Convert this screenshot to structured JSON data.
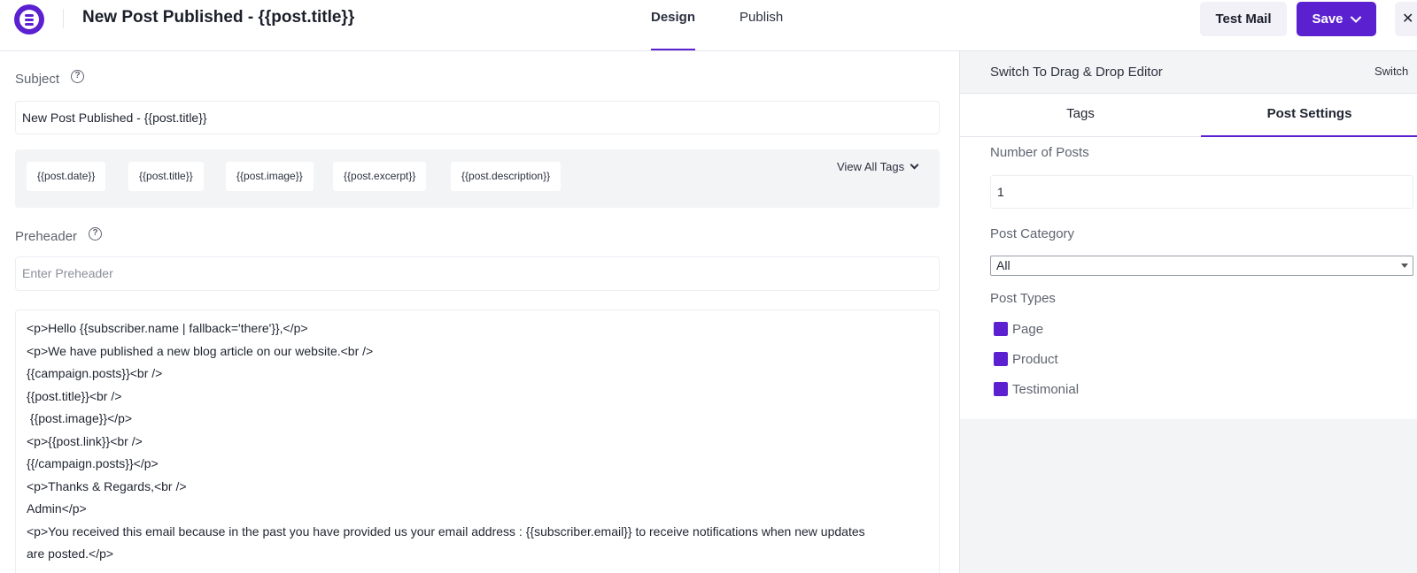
{
  "header": {
    "title": "New Post Published - {{post.title}}",
    "tabs": [
      "Design",
      "Publish"
    ],
    "test_mail_label": "Test Mail",
    "save_label": "Save",
    "close_glyph": "✕"
  },
  "editor": {
    "subject_label": "Subject",
    "subject_value": "New Post Published - {{post.title}}",
    "tags": [
      "{{post.date}}",
      "{{post.title}}",
      "{{post.image}}",
      "{{post.excerpt}}",
      "{{post.description}}"
    ],
    "view_all_tags_label": "View All Tags",
    "preheader_label": "Preheader",
    "preheader_placeholder": "Enter Preheader",
    "body_lines": [
      "<p>Hello {{subscriber.name | fallback='there'}},</p>",
      "<p>We have published a new blog article on our website.<br />",
      "{{campaign.posts}}<br />",
      "{{post.title}}<br />",
      " {{post.image}}</p>",
      "<p>{{post.link}}<br />",
      "{{/campaign.posts}}</p>",
      "<p>Thanks & Regards,<br />",
      "Admin</p>",
      "<p>You received this email because in the past you have provided us your email address : {{subscriber.email}} to receive notifications when new updates",
      "are posted.</p>"
    ]
  },
  "sidebar": {
    "switch_text": "Switch To Drag & Drop Editor",
    "switch_button": "Switch",
    "tabs": [
      "Tags",
      "Post Settings"
    ],
    "number_of_posts_label": "Number of Posts",
    "number_of_posts_value": "1",
    "post_category_label": "Post Category",
    "post_category_value": "All",
    "post_types_label": "Post Types",
    "post_types": [
      "Page",
      "Product",
      "Testimonial"
    ]
  },
  "colors": {
    "accent": "#5b21d1",
    "panel_bg": "#f3f4f6",
    "chip_bg": "#ffffff",
    "test_mail_bg": "#f2f1f8"
  },
  "icons": {
    "logo": "brand-logo-icon",
    "help": "question-circle-icon",
    "save_caret": "chevron-down-icon",
    "view_all_caret": "chevron-down-icon",
    "close": "close-icon"
  }
}
